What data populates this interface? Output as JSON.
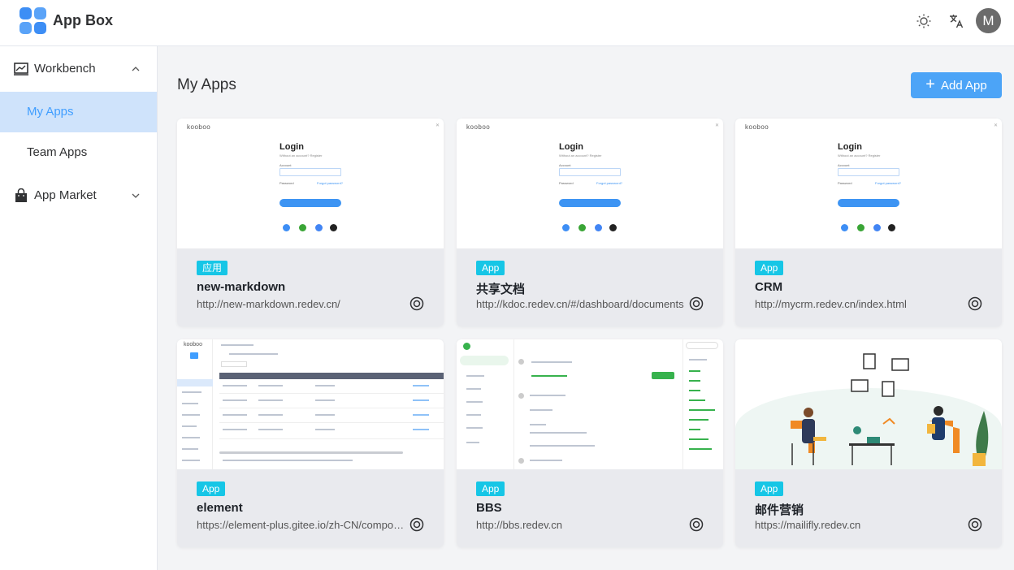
{
  "header": {
    "app_title": "App Box",
    "avatar_initial": "M"
  },
  "sidebar": {
    "workbench_label": "Workbench",
    "my_apps_label": "My Apps",
    "team_apps_label": "Team Apps",
    "app_market_label": "App Market"
  },
  "main": {
    "page_title": "My Apps",
    "add_app_label": "Add App"
  },
  "login_thumb": {
    "brand": "kooboo",
    "title": "Login",
    "subtitle": "Without an account? Register",
    "account_label": "Account",
    "password_label": "Password",
    "forgot": "Forgot password?"
  },
  "apps": [
    {
      "tag": "应用",
      "name": "new-markdown",
      "url": "http://new-markdown.redev.cn/"
    },
    {
      "tag": "App",
      "name": "共享文档",
      "url": "http://kdoc.redev.cn/#/dashboard/documents"
    },
    {
      "tag": "App",
      "name": "CRM",
      "url": "http://mycrm.redev.cn/index.html"
    },
    {
      "tag": "App",
      "name": "element",
      "url": "https://element-plus.gitee.io/zh-CN/component/table.html"
    },
    {
      "tag": "App",
      "name": "BBS",
      "url": "http://bbs.redev.cn"
    },
    {
      "tag": "App",
      "name": "邮件营销",
      "url": "https://mailifly.redev.cn"
    }
  ],
  "colors": {
    "primary": "#409eff",
    "tag": "#16c6e6",
    "active_bg": "#cfe3fb"
  }
}
